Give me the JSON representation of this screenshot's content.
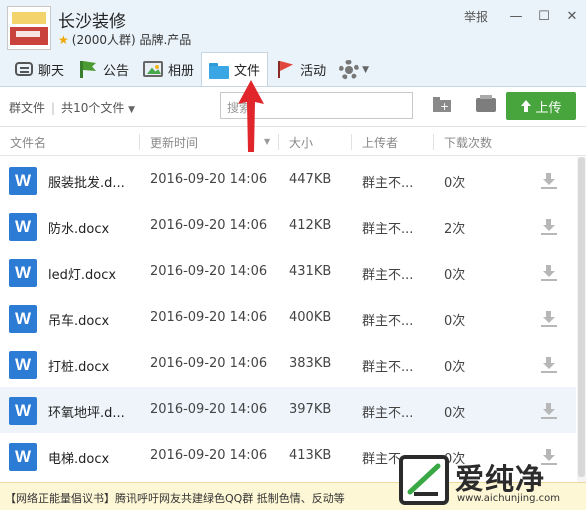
{
  "group": {
    "name": "长沙装修",
    "subtitle": "(2000人群) 品牌.产品"
  },
  "window": {
    "report_label": "举报",
    "min_glyph": "—",
    "max_glyph": "☐",
    "close_glyph": "✕"
  },
  "tabs": [
    {
      "label": "聊天",
      "icon": "chat-icon"
    },
    {
      "label": "公告",
      "icon": "notice-flag-icon"
    },
    {
      "label": "相册",
      "icon": "album-icon"
    },
    {
      "label": "文件",
      "icon": "folder-icon",
      "active": true
    },
    {
      "label": "活动",
      "icon": "activity-flag-icon"
    }
  ],
  "toolbar": {
    "group_files_label": "群文件",
    "count_label": "共10个文件",
    "search_placeholder": "搜索",
    "upload_label": "上传"
  },
  "columns": {
    "name": "文件名",
    "time": "更新时间",
    "size": "大小",
    "uploader": "上传者",
    "downloads": "下载次数"
  },
  "files": [
    {
      "name": "服装批发.d...",
      "time": "2016-09-20 14:06",
      "size": "447KB",
      "uploader": "群主不...",
      "downloads": "0次"
    },
    {
      "name": "防水.docx",
      "time": "2016-09-20 14:06",
      "size": "412KB",
      "uploader": "群主不...",
      "downloads": "2次"
    },
    {
      "name": "led灯.docx",
      "time": "2016-09-20 14:06",
      "size": "431KB",
      "uploader": "群主不...",
      "downloads": "0次"
    },
    {
      "name": "吊车.docx",
      "time": "2016-09-20 14:06",
      "size": "400KB",
      "uploader": "群主不...",
      "downloads": "0次"
    },
    {
      "name": "打桩.docx",
      "time": "2016-09-20 14:06",
      "size": "383KB",
      "uploader": "群主不...",
      "downloads": "0次"
    },
    {
      "name": "环氧地坪.d...",
      "time": "2016-09-20 14:06",
      "size": "397KB",
      "uploader": "群主不...",
      "downloads": "0次",
      "selected": true
    },
    {
      "name": "电梯.docx",
      "time": "2016-09-20 14:06",
      "size": "413KB",
      "uploader": "群主不...",
      "downloads": "0次"
    }
  ],
  "banner": {
    "text": "【网络正能量倡议书】腾讯呼吁网友共建绿色QQ群 抵制色情、反动等"
  },
  "watermark": {
    "title": "爱纯净",
    "url": "www.aichunjing.com"
  },
  "colors": {
    "accent_blue": "#2c7bd4",
    "upload_green": "#48a53d",
    "header_bg": "#eaf3fa",
    "arrow_red": "#e0262b"
  }
}
